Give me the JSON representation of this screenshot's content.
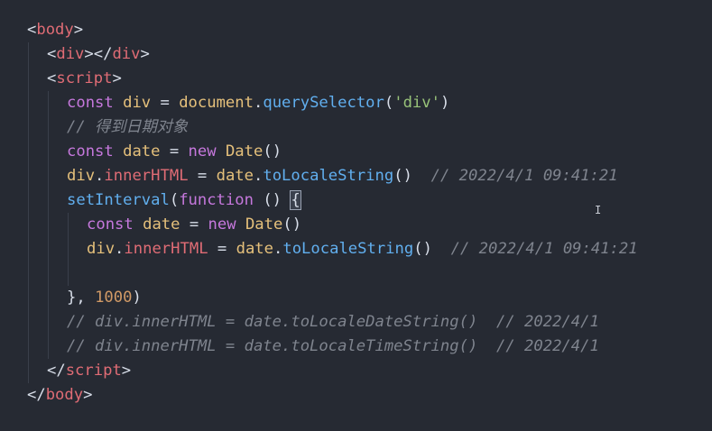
{
  "code_lines": [
    {
      "indent": 0,
      "tokens": [
        {
          "t": "<",
          "c": "punc"
        },
        {
          "t": "body",
          "c": "tag"
        },
        {
          "t": ">",
          "c": "punc"
        }
      ]
    },
    {
      "indent": 1,
      "tokens": [
        {
          "t": "<",
          "c": "punc"
        },
        {
          "t": "div",
          "c": "tag"
        },
        {
          "t": "></",
          "c": "punc"
        },
        {
          "t": "div",
          "c": "tag"
        },
        {
          "t": ">",
          "c": "punc"
        }
      ]
    },
    {
      "indent": 1,
      "tokens": [
        {
          "t": "<",
          "c": "punc"
        },
        {
          "t": "script",
          "c": "tag"
        },
        {
          "t": ">",
          "c": "punc"
        }
      ]
    },
    {
      "indent": 2,
      "tokens": [
        {
          "t": "const ",
          "c": "kw"
        },
        {
          "t": "div",
          "c": "var"
        },
        {
          "t": " = ",
          "c": "plain"
        },
        {
          "t": "document",
          "c": "var"
        },
        {
          "t": ".",
          "c": "plain"
        },
        {
          "t": "querySelector",
          "c": "fn"
        },
        {
          "t": "(",
          "c": "plain"
        },
        {
          "t": "'div'",
          "c": "str"
        },
        {
          "t": ")",
          "c": "plain"
        }
      ]
    },
    {
      "indent": 2,
      "tokens": [
        {
          "t": "// 得到日期对象",
          "c": "com"
        }
      ]
    },
    {
      "indent": 2,
      "tokens": [
        {
          "t": "const ",
          "c": "kw"
        },
        {
          "t": "date",
          "c": "var"
        },
        {
          "t": " = ",
          "c": "plain"
        },
        {
          "t": "new ",
          "c": "kw"
        },
        {
          "t": "Date",
          "c": "var"
        },
        {
          "t": "()",
          "c": "plain"
        }
      ]
    },
    {
      "indent": 2,
      "tokens": [
        {
          "t": "div",
          "c": "var"
        },
        {
          "t": ".",
          "c": "plain"
        },
        {
          "t": "innerHTML",
          "c": "prop"
        },
        {
          "t": " = ",
          "c": "plain"
        },
        {
          "t": "date",
          "c": "var"
        },
        {
          "t": ".",
          "c": "plain"
        },
        {
          "t": "toLocaleString",
          "c": "fn"
        },
        {
          "t": "()  ",
          "c": "plain"
        },
        {
          "t": "// 2022/4/1 09:41:21",
          "c": "com"
        }
      ]
    },
    {
      "indent": 2,
      "tokens": [
        {
          "t": "setInterval",
          "c": "fn"
        },
        {
          "t": "(",
          "c": "plain"
        },
        {
          "t": "function",
          "c": "kw"
        },
        {
          "t": " () ",
          "c": "plain"
        },
        {
          "t": "{",
          "c": "cursor"
        }
      ]
    },
    {
      "indent": 3,
      "tokens": [
        {
          "t": "const ",
          "c": "kw"
        },
        {
          "t": "date",
          "c": "var"
        },
        {
          "t": " = ",
          "c": "plain"
        },
        {
          "t": "new ",
          "c": "kw"
        },
        {
          "t": "Date",
          "c": "var"
        },
        {
          "t": "()",
          "c": "plain"
        }
      ]
    },
    {
      "indent": 3,
      "tokens": [
        {
          "t": "div",
          "c": "var"
        },
        {
          "t": ".",
          "c": "plain"
        },
        {
          "t": "innerHTML",
          "c": "prop"
        },
        {
          "t": " = ",
          "c": "plain"
        },
        {
          "t": "date",
          "c": "var"
        },
        {
          "t": ".",
          "c": "plain"
        },
        {
          "t": "toLocaleString",
          "c": "fn"
        },
        {
          "t": "()  ",
          "c": "plain"
        },
        {
          "t": "// 2022/4/1 09:41:21",
          "c": "com"
        }
      ]
    },
    {
      "indent": 3,
      "tokens": []
    },
    {
      "indent": 2,
      "tokens": [
        {
          "t": "}",
          "c": "plain"
        },
        {
          "t": ", ",
          "c": "plain"
        },
        {
          "t": "1000",
          "c": "num"
        },
        {
          "t": ")",
          "c": "plain"
        }
      ]
    },
    {
      "indent": 2,
      "tokens": [
        {
          "t": "// div.innerHTML = date.toLocaleDateString()  // 2022/4/1",
          "c": "com"
        }
      ]
    },
    {
      "indent": 2,
      "tokens": [
        {
          "t": "// div.innerHTML = date.toLocaleTimeString()  // 2022/4/1",
          "c": "com"
        }
      ]
    },
    {
      "indent": 1,
      "tokens": [
        {
          "t": "</",
          "c": "punc"
        },
        {
          "t": "script",
          "c": "tag"
        },
        {
          "t": ">",
          "c": "punc"
        }
      ]
    },
    {
      "indent": 0,
      "tokens": [
        {
          "t": "</",
          "c": "punc"
        },
        {
          "t": "body",
          "c": "tag"
        },
        {
          "t": ">",
          "c": "punc"
        }
      ]
    }
  ],
  "colors": {
    "background": "#262a33",
    "tag": "#e06c75",
    "keyword": "#c678dd",
    "variable": "#e5c07b",
    "function": "#61afef",
    "string": "#98c379",
    "number": "#d19a66",
    "comment": "#7f848e"
  },
  "mouse_cursor_icon": "text-ibeam-icon"
}
